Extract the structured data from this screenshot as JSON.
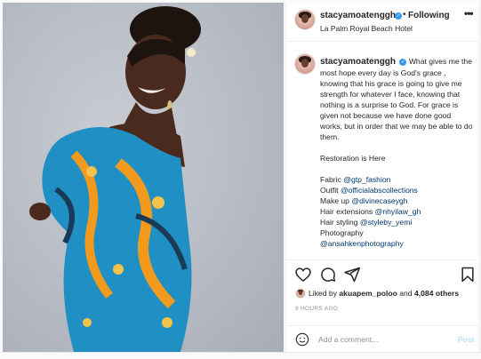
{
  "post": {
    "username": "stacyamoatenggh",
    "follow_label": "Following",
    "separator": "•",
    "location": "La Palm Royal Beach Hotel",
    "more_label": "•••"
  },
  "caption": {
    "username": "stacyamoatenggh",
    "text": "What gives me the most hope every day is God's grace , knowing that his grace is going to give me strength for whatever I face, knowing that nothing is a surprise to God. For grace is given not because we have done good works, but in order that we may be able to do them.",
    "line2": "Restoration is Here",
    "credits": [
      {
        "label": "Fabric ",
        "handle": "@gtp_fashion"
      },
      {
        "label": "Outfit ",
        "handle": "@officialabscollections"
      },
      {
        "label": "Make up ",
        "handle": "@divinecaseygh"
      },
      {
        "label": "Hair extensions ",
        "handle": "@nhyilaw_gh"
      },
      {
        "label": "Hair styling ",
        "handle": "@styleby_yemi"
      },
      {
        "label": "Photography",
        "handle": ""
      },
      {
        "label": "",
        "handle": "@ansahkenphotography"
      }
    ]
  },
  "actions": {
    "like_icon": "heart-icon",
    "comment_icon": "comment-icon",
    "share_icon": "paper-plane-icon",
    "save_icon": "bookmark-icon"
  },
  "likes": {
    "prefix": "Liked by ",
    "user": "akuapem_poloo",
    "middle": " and ",
    "count": "4,084 others"
  },
  "timestamp": "9 HOURS AGO",
  "comment": {
    "placeholder": "Add a comment...",
    "post_label": "Post"
  },
  "colors": {
    "link": "#00376b",
    "verified": "#3897f0",
    "post_disabled": "#b2dffc",
    "secondary_text": "#8e8e8e"
  }
}
